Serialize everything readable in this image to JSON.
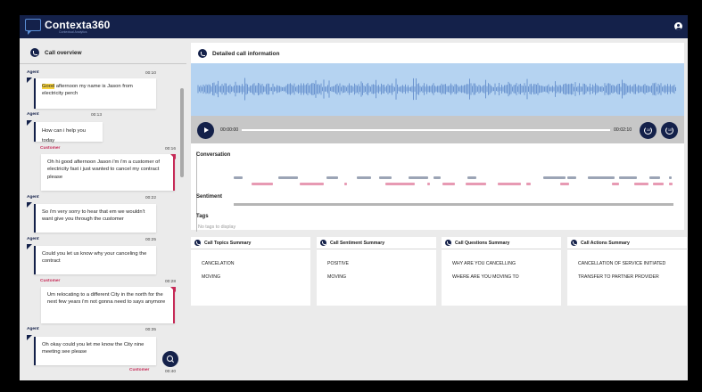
{
  "app": {
    "logo_text": "Contexta360",
    "logo_sub": "Contextual Analytics"
  },
  "overview": {
    "title": "Call overview"
  },
  "messages": [
    {
      "role": "Agent",
      "time": "00:10",
      "highlight": "Good",
      "rest": " afternoon my name is Jason from electricity perch"
    },
    {
      "role": "Agent",
      "time": "00:13",
      "text": "How can i help you today"
    },
    {
      "role": "Customer",
      "time": "00:16",
      "text": "Oh hi good afternoon Jason i'm i'm a customer of electricity fast i just wanted to cancel my contract please"
    },
    {
      "role": "Agent",
      "time": "00:22",
      "text": "So i'm very sorry to hear that em we wouldn't want give you through the customer"
    },
    {
      "role": "Agent",
      "time": "00:25",
      "text": "Could you let us know why your canceling the contract"
    },
    {
      "role": "Customer",
      "time": "00:28",
      "text": "Um relocating to a different City in the north for the next few years i'm not gonna need to says anymore"
    },
    {
      "role": "Agent",
      "time": "00:35",
      "text": "Oh okay could you let me know the City nine meeting see please"
    },
    {
      "role": "Customer",
      "time": "00:40",
      "text": ""
    }
  ],
  "detail": {
    "title": "Detailed call information",
    "current_time": "00:00:00",
    "duration": "00:02:10",
    "rewind_label": "10",
    "forward_label": "10",
    "conversation_label": "Conversation",
    "sentiment_label": "Sentiment",
    "tags_label": "Tags",
    "no_tags": "No tags to display"
  },
  "colors": {
    "agent": "#14214a",
    "customer": "#c62a57",
    "wave_bg": "#b5d3f1",
    "wave": "#5a86c9"
  },
  "summaries": [
    {
      "title": "Call Topics Summary",
      "items": [
        "CANCELATION",
        "MOVING"
      ]
    },
    {
      "title": "Call Sentiment Summary",
      "items": [
        "POSITIVE",
        "MOVING"
      ]
    },
    {
      "title": "Call Questions Summary",
      "items": [
        "WHY ARE YOU CANCELLING",
        "WHERE ARE YOU MOVING TO"
      ]
    },
    {
      "title": "Call Actions Summary",
      "items": [
        "CANCELLATION OF SERVICE INITIATED",
        "TRANSFER TO PARTNER PROVIDER"
      ]
    }
  ]
}
